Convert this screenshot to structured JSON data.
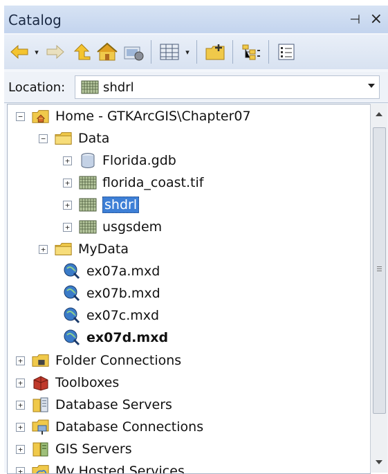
{
  "window": {
    "title": "Catalog",
    "pin_glyph": "⊣",
    "close_glyph": "×"
  },
  "toolbar": {
    "buttons": [
      {
        "name": "back-button",
        "icon": "arrow-left-icon"
      },
      {
        "name": "forward-button",
        "icon": "arrow-right-icon"
      },
      {
        "name": "up-button",
        "icon": "up-level-icon"
      },
      {
        "name": "home-button",
        "icon": "home-icon"
      },
      {
        "name": "connect-button",
        "icon": "connect-icon"
      },
      {
        "name": "view-options-button",
        "icon": "grid-view-icon"
      },
      {
        "name": "new-folder-button",
        "icon": "new-folder-icon"
      },
      {
        "name": "toggle-contents-button",
        "icon": "tree-icon"
      },
      {
        "name": "options-button",
        "icon": "list-icon"
      }
    ]
  },
  "location": {
    "label": "Location:",
    "value": "shdrl"
  },
  "tree": {
    "home": "Home - GTKArcGIS\\Chapter07",
    "data_folder": "Data",
    "data_items": [
      "Florida.gdb",
      "florida_coast.tif",
      "shdrl",
      "usgsdem"
    ],
    "mydata_folder": "MyData",
    "mxd_files": [
      "ex07a.mxd",
      "ex07b.mxd",
      "ex07c.mxd",
      "ex07d.mxd"
    ],
    "root_items": [
      "Folder Connections",
      "Toolboxes",
      "Database Servers",
      "Database Connections",
      "GIS Servers",
      "My Hosted Services"
    ]
  },
  "colors": {
    "selection": "#3d7fd6",
    "title_bg": "#c3d4ee",
    "folder": "#f0c94a"
  }
}
